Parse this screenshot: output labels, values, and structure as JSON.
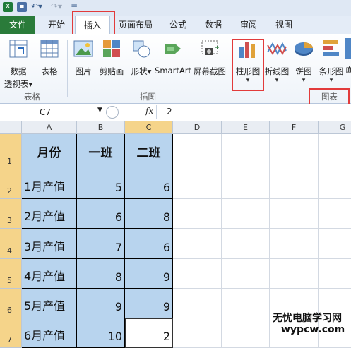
{
  "quick_access": {
    "icons": [
      "excel-icon",
      "save-icon",
      "undo-icon",
      "redo-icon"
    ]
  },
  "tabs": [
    {
      "label": "文件"
    },
    {
      "label": "开始"
    },
    {
      "label": "插入"
    },
    {
      "label": "页面布局"
    },
    {
      "label": "公式"
    },
    {
      "label": "数据"
    },
    {
      "label": "审阅"
    },
    {
      "label": "视图"
    }
  ],
  "ribbon": {
    "table_group": {
      "pivot_label_1": "数据",
      "pivot_label_2": "透视表",
      "pivot_dropdown": "▾",
      "table_label": "表格",
      "group_label": "表格"
    },
    "illustrations_group": {
      "picture": "图片",
      "clipart": "剪贴画",
      "shapes": "形状",
      "smartart": "SmartArt",
      "screenshot": "屏幕截图",
      "group_label": "插图"
    },
    "charts_group": {
      "column": "柱形图",
      "line": "折线图",
      "pie": "饼图",
      "bar": "条形图",
      "more": "面",
      "group_label": "图表"
    }
  },
  "formula_bar": {
    "name_box": "C7",
    "fx": "fx",
    "value": "2"
  },
  "columns": [
    "A",
    "B",
    "C",
    "D",
    "E",
    "F",
    "G"
  ],
  "rows": [
    "1",
    "2",
    "3",
    "4",
    "5",
    "6",
    "7"
  ],
  "table": {
    "headers": [
      "月份",
      "一班",
      "二班"
    ],
    "data": [
      [
        "1月产值",
        "5",
        "6"
      ],
      [
        "2月产值",
        "6",
        "8"
      ],
      [
        "3月产值",
        "7",
        "6"
      ],
      [
        "4月产值",
        "8",
        "9"
      ],
      [
        "5月产值",
        "9",
        "9"
      ],
      [
        "6月产值",
        "10",
        "2"
      ]
    ]
  },
  "watermark": {
    "line1": "无忧电脑学习网",
    "line2": "wypcw.com"
  },
  "colors": {
    "file_tab": "#2a7b3a",
    "highlight": "#e23b3b",
    "cell_fill": "#b8d4ee"
  }
}
